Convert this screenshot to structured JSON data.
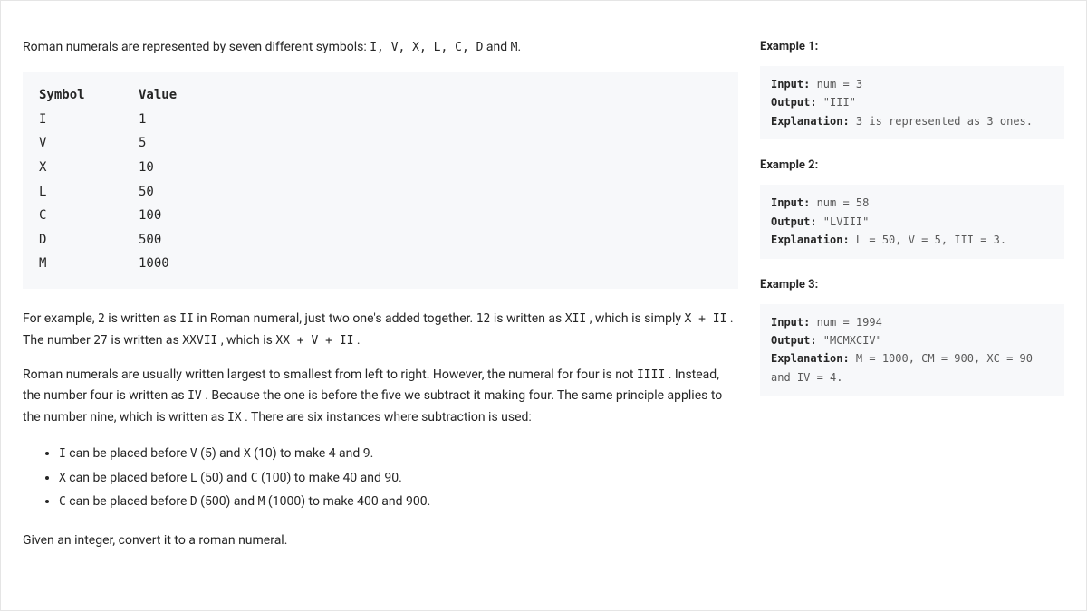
{
  "intro": {
    "prefix": "Roman numerals are represented by seven different symbols: ",
    "symbols_list": "I, V, X, L, C, D",
    "and": " and ",
    "last_symbol": "M",
    "period": "."
  },
  "table": {
    "head_symbol": "Symbol",
    "head_value": "Value",
    "rows": [
      {
        "sym": "I",
        "val": "1"
      },
      {
        "sym": "V",
        "val": "5"
      },
      {
        "sym": "X",
        "val": "10"
      },
      {
        "sym": "L",
        "val": "50"
      },
      {
        "sym": "C",
        "val": "100"
      },
      {
        "sym": "D",
        "val": "500"
      },
      {
        "sym": "M",
        "val": "1000"
      }
    ]
  },
  "para2": {
    "t0": "For example, ",
    "c0": "2",
    "t1": " is written as ",
    "c1": "II",
    "t2": " in Roman numeral, just two one's added together. ",
    "c2": "12",
    "t3": " is written as ",
    "c3": "XII",
    "t4": " , which is simply ",
    "c4": "X + II",
    "t5": " . The number ",
    "c5": "27",
    "t6": " is written as ",
    "c6": "XXVII",
    "t7": " , which is ",
    "c7": "XX + V + II",
    "t8": " ."
  },
  "para3": {
    "t0": "Roman numerals are usually written largest to smallest from left to right. However, the numeral for four is not ",
    "c0": "IIII",
    "t1": " . Instead, the number four is written as ",
    "c1": "IV",
    "t2": " . Because the one is before the five we subtract it making four. The same principle applies to the number nine, which is written as ",
    "c2": "IX",
    "t3": " . There are six instances where subtraction is used:"
  },
  "bullets": [
    {
      "c0": "I",
      "t0": " can be placed before ",
      "c1": "V",
      "t1": " (5) and ",
      "c2": "X",
      "t2": " (10) to make 4 and 9."
    },
    {
      "c0": "X",
      "t0": " can be placed before ",
      "c1": "L",
      "t1": " (50) and ",
      "c2": "C",
      "t2": " (100) to make 40 and 90."
    },
    {
      "c0": "C",
      "t0": " can be placed before ",
      "c1": "D",
      "t1": " (500) and ",
      "c2": "M",
      "t2": " (1000) to make 400 and 900."
    }
  ],
  "para4": "Given an integer, convert it to a roman numeral.",
  "examples": [
    {
      "title": "Example 1:",
      "input_label": "Input:",
      "input_val": " num = 3",
      "output_label": "Output:",
      "output_val": " \"III\"",
      "expl_label": "Explanation:",
      "expl_val": " 3 is represented as 3 ones."
    },
    {
      "title": "Example 2:",
      "input_label": "Input:",
      "input_val": " num = 58",
      "output_label": "Output:",
      "output_val": " \"LVIII\"",
      "expl_label": "Explanation:",
      "expl_val": " L = 50, V = 5, III = 3."
    },
    {
      "title": "Example 3:",
      "input_label": "Input:",
      "input_val": " num = 1994",
      "output_label": "Output:",
      "output_val": " \"MCMXCIV\"",
      "expl_label": "Explanation:",
      "expl_val": " M = 1000, CM = 900, XC = 90 and IV = 4."
    }
  ]
}
